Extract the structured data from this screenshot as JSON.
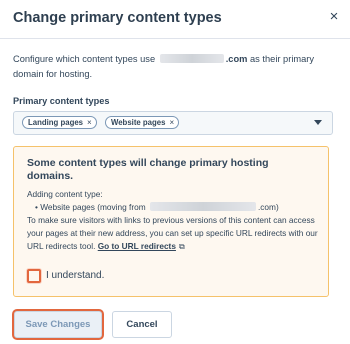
{
  "modal": {
    "title": "Change primary content types",
    "close_glyph": "×"
  },
  "description": {
    "part1": "Configure which content types use ",
    "domain_suffix": ".com",
    "part2": " as their primary domain for hosting."
  },
  "field": {
    "label": "Primary content types",
    "tags": [
      {
        "label": "Landing pages",
        "remove": "×"
      },
      {
        "label": "Website pages",
        "remove": "×"
      }
    ]
  },
  "alert": {
    "title": "Some content types will change primary hosting domains.",
    "adding_label": "Adding content type:",
    "bullet_prefix": "• Website pages (moving from ",
    "bullet_suffix": ".com)",
    "body": "To make sure visitors with links to previous versions of this content can access your pages at their new address, you can set up specific URL redirects with our URL redirects tool.",
    "link_text": "Go to URL redirects",
    "link_icon": "external-link-icon",
    "accent_color": "#f5c26b",
    "background_color": "#fef8f0"
  },
  "confirm": {
    "label": "I understand.",
    "checked": false
  },
  "footer": {
    "save_label": "Save Changes",
    "cancel_label": "Cancel"
  }
}
